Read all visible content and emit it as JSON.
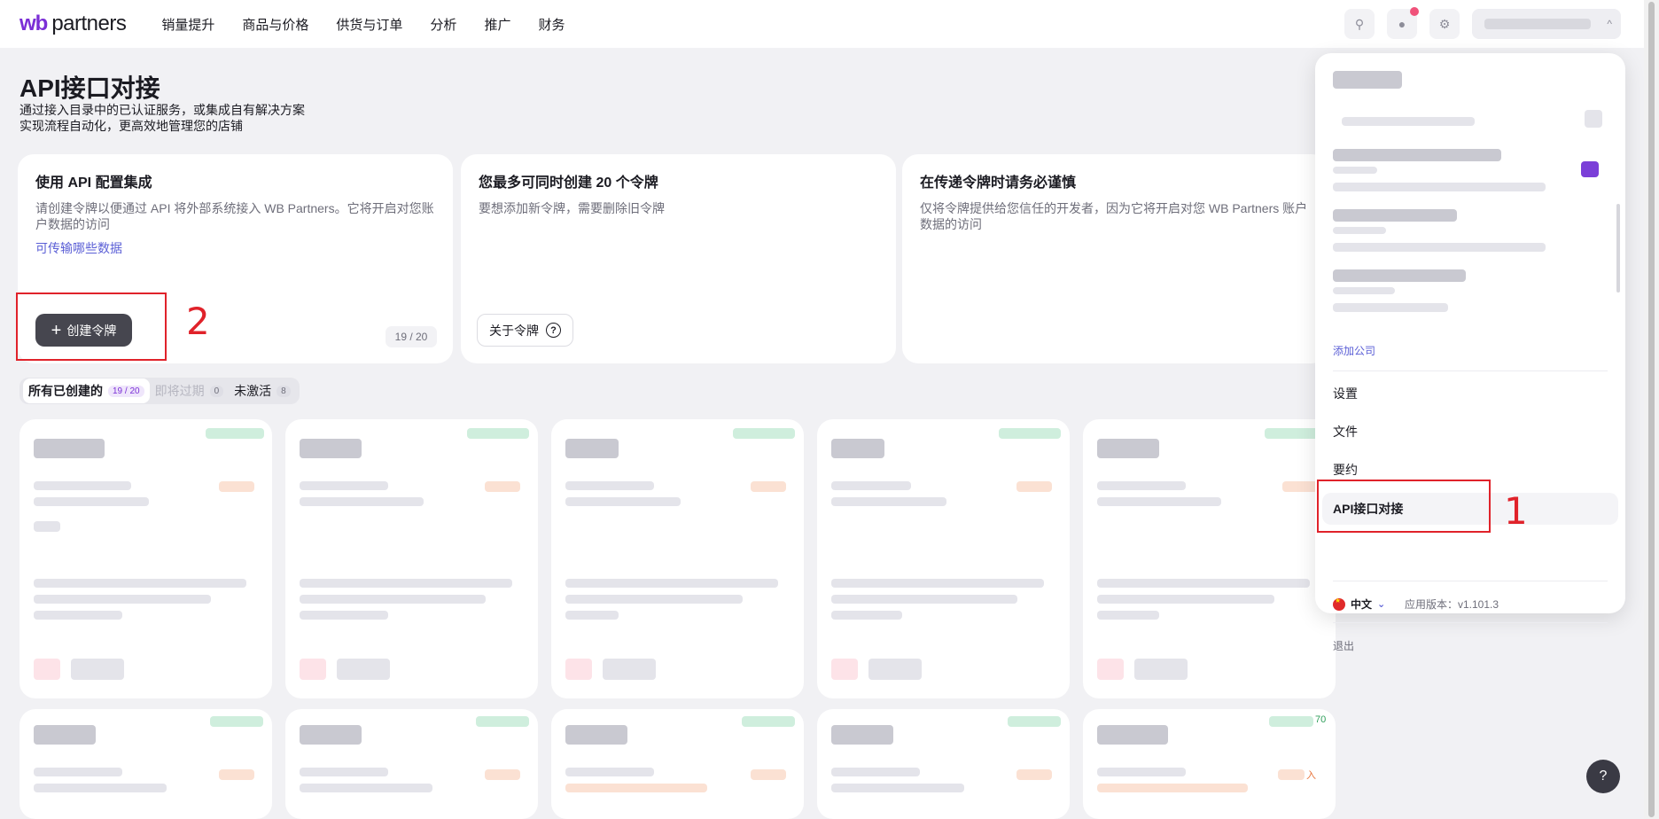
{
  "logo": {
    "wb": "wb",
    "partners": "partners"
  },
  "nav": [
    {
      "label": "销量提升"
    },
    {
      "label": "商品与价格"
    },
    {
      "label": "供货与订单"
    },
    {
      "label": "分析"
    },
    {
      "label": "推广"
    },
    {
      "label": "财务"
    }
  ],
  "page": {
    "title": "API接口对接",
    "subtitle_line1": "通过接入目录中的已认证服务，或集成自有解决方案",
    "subtitle_line2": "实现流程自动化，更高效地管理您的店铺"
  },
  "cards": {
    "c1": {
      "title": "使用 API 配置集成",
      "text": "请创建令牌以便通过 API 将外部系统接入 WB Partners。它将开启对您账户数据的访问",
      "link": "可传输哪些数据",
      "button": "创建令牌",
      "counter": "19 / 20"
    },
    "c2": {
      "title": "您最多可同时创建 20 个令牌",
      "text": "要想添加新令牌，需要删除旧令牌",
      "button": "关于令牌"
    },
    "c3": {
      "title": "在传递令牌时请务必谨慎",
      "text": "仅将令牌提供给您信任的开发者，因为它将开启对您 WB Partners 账户数据的访问"
    }
  },
  "filters": {
    "all": "所有已创建的",
    "all_count": "19 / 20",
    "expiring": "即将过期",
    "expiring_count": "0",
    "inactive": "未激活",
    "inactive_count": "8"
  },
  "annotations": {
    "one": "1",
    "two": "2"
  },
  "menu": {
    "add_company": "添加公司",
    "settings": "设置",
    "documents": "文件",
    "agreement": "要约",
    "api": "API接口对接",
    "language": "中文",
    "version": "应用版本：v1.101.3",
    "logout": "退出"
  },
  "partial_visible": {
    "card_badge_suffix": "70",
    "card_tag_suffix": "入"
  },
  "help": "?",
  "colors": {
    "brand": "#7b2fd6",
    "link": "#5b5fd6",
    "annotation": "#e0222a"
  }
}
